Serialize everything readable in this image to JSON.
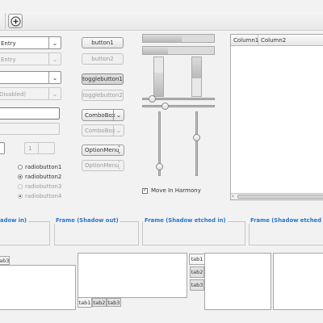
{
  "toolbar": {
    "add_icon": "circle-plus-icon"
  },
  "col1": {
    "combo_entry_text": "Entry",
    "combo_entry_disabled_text": "Entry",
    "combo_disabled_text": "Disabled)",
    "spin_value": "1",
    "radios": [
      {
        "label": "radiobutton1",
        "checked": false,
        "disabled": false
      },
      {
        "label": "radiobutton2",
        "checked": true,
        "disabled": false
      },
      {
        "label": "radiobutton3",
        "checked": false,
        "disabled": true
      },
      {
        "label": "radiobutton4",
        "checked": true,
        "disabled": true
      }
    ]
  },
  "col2": {
    "button1": "button1",
    "button2": "button2",
    "togglebutton1": "togglebutton1",
    "togglebutton2": "togglebutton2",
    "combobox1": "ComboBox",
    "combobox2": "ComboBox",
    "optionmenu1": "OptionMenu",
    "optionmenu2": "OptionMenu"
  },
  "col3": {
    "checkbox_label": "Move In Harmony",
    "checkbox_checked": true,
    "hprogress_levels": [
      0.55,
      0.35
    ],
    "hscale_levels": [
      0.1,
      0.3
    ],
    "vscale_levels": [
      0.9,
      0.4
    ]
  },
  "tree": {
    "columns": [
      "Column1",
      "Column2"
    ]
  },
  "frames": {
    "f1": "adow in)",
    "f2": "Frame (Shadow out)",
    "f3": "Frame (Shadow etched in)",
    "f4": "Frame (Shadow etched out)"
  },
  "notebooks": {
    "nb1_tabs": [
      "tab3"
    ],
    "nb2_tabs": [
      "tab1",
      "tab2",
      "tab3"
    ],
    "nb3_tabs": [
      "tab1",
      "tab2",
      "tab3"
    ]
  }
}
